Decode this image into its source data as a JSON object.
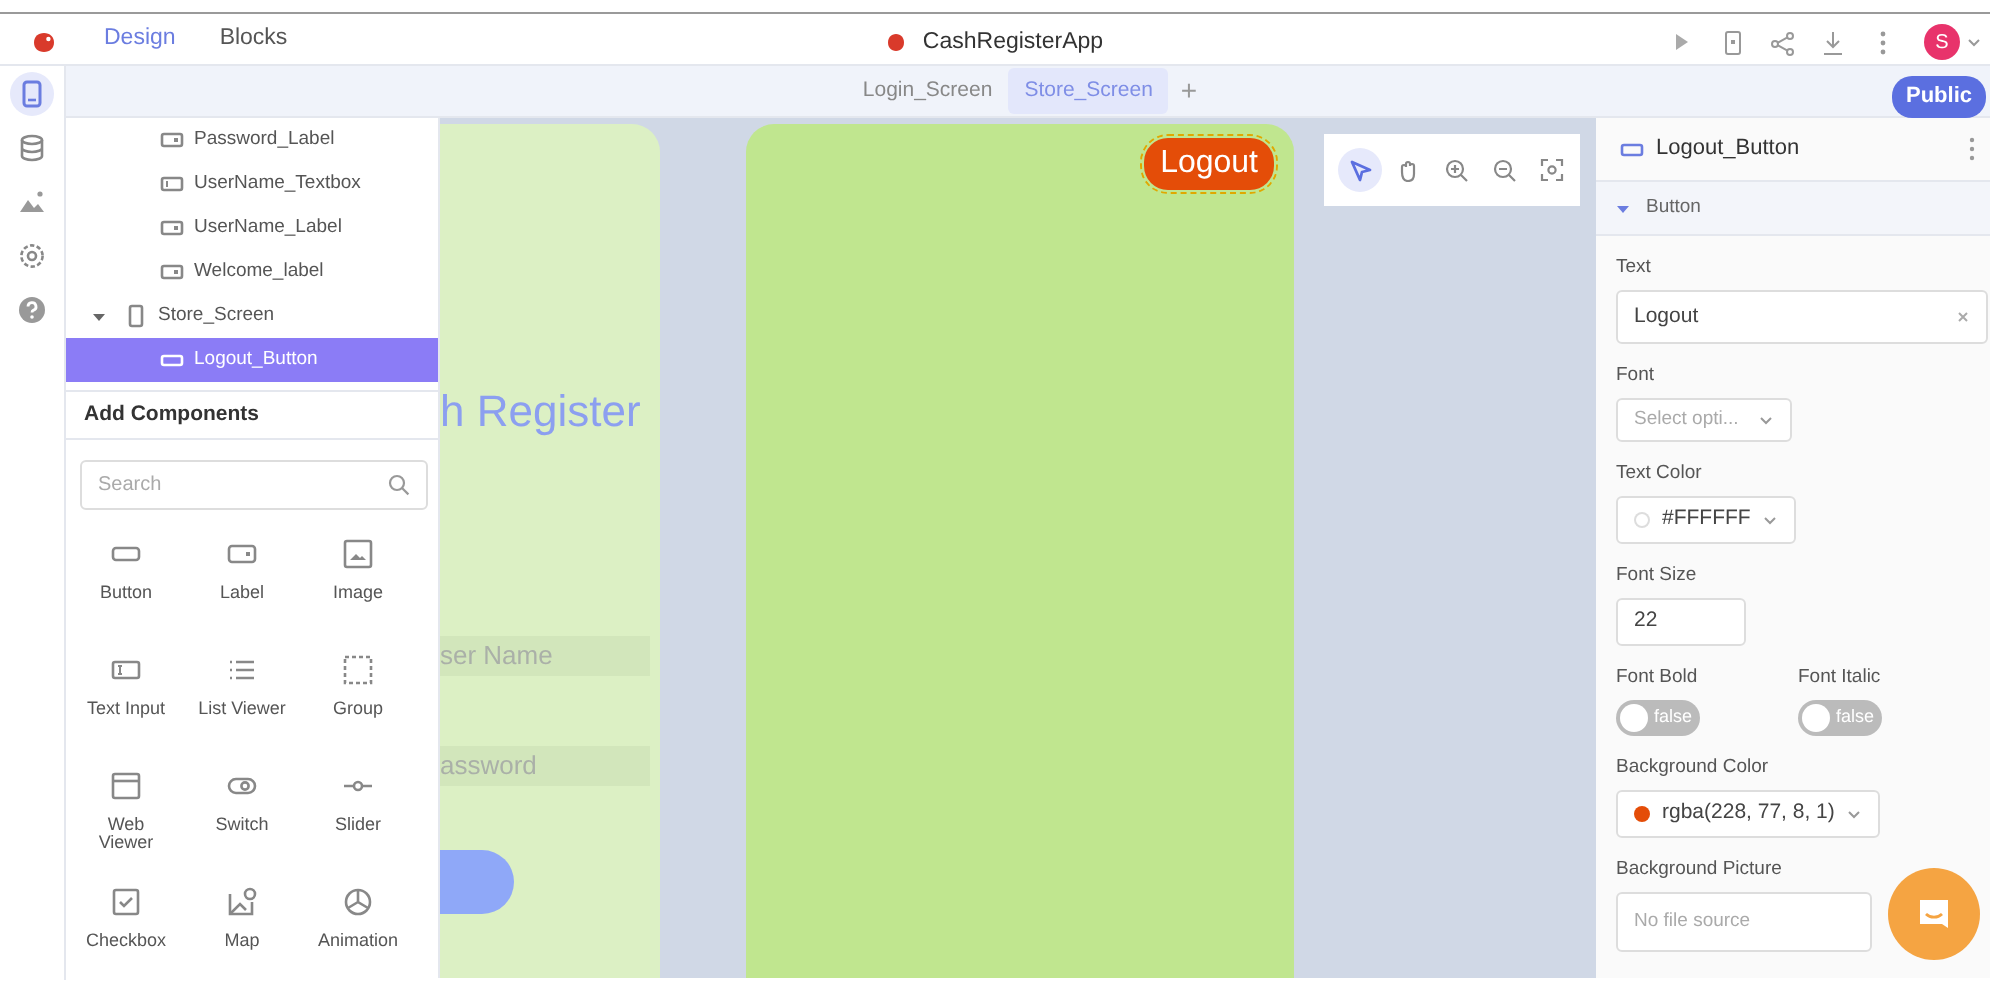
{
  "app": {
    "title": "CashRegisterApp"
  },
  "mode_tabs": [
    {
      "label": "Design",
      "selected": true
    },
    {
      "label": "Blocks",
      "selected": false
    }
  ],
  "avatar": {
    "initial": "S"
  },
  "rail": [
    {
      "kind": "device",
      "selected": true
    },
    {
      "kind": "database",
      "selected": false
    },
    {
      "kind": "media",
      "selected": false
    },
    {
      "kind": "settings",
      "selected": false
    },
    {
      "kind": "help",
      "selected": false
    }
  ],
  "screen_tabs": [
    {
      "label": "Login_Screen",
      "selected": false
    },
    {
      "label": "Store_Screen",
      "selected": true
    }
  ],
  "add_tab": "+",
  "visibility_badge": "Public",
  "tree": [
    {
      "children": [
        {
          "label": "Password_Label",
          "kind": "label",
          "selected": false
        },
        {
          "label": "UserName_Textbox",
          "kind": "textbox",
          "selected": false
        },
        {
          "label": "UserName_Label",
          "kind": "label",
          "selected": false
        },
        {
          "label": "Welcome_label",
          "kind": "label",
          "selected": false
        }
      ]
    },
    {
      "label": "Store_Screen",
      "kind": "screen",
      "expanded": true,
      "selected": false,
      "children": [
        {
          "label": "Logout_Button",
          "kind": "button",
          "selected": true
        }
      ]
    }
  ],
  "add_components": {
    "title": "Add Components",
    "search": {
      "placeholder": "Search"
    },
    "items": [
      {
        "label": "Button",
        "kind": "button"
      },
      {
        "label": "Label",
        "kind": "label"
      },
      {
        "label": "Image",
        "kind": "image"
      },
      {
        "label": "Text Input",
        "kind": "text_input"
      },
      {
        "label": "List Viewer",
        "kind": "list_viewer"
      },
      {
        "label": "Group",
        "kind": "group"
      },
      {
        "label": "Web Viewer",
        "kind": "web_viewer"
      },
      {
        "label": "Switch",
        "kind": "switch"
      },
      {
        "label": "Slider",
        "kind": "slider"
      },
      {
        "label": "Checkbox",
        "kind": "checkbox"
      },
      {
        "label": "Map",
        "kind": "map"
      },
      {
        "label": "Animation",
        "kind": "animation"
      }
    ]
  },
  "login_preview": {
    "heading": "h Register",
    "fields": [
      "ser Name",
      "assword"
    ]
  },
  "store_preview": {
    "button": "Logout",
    "selected": true
  },
  "tools": [
    {
      "kind": "pointer",
      "selected": true
    },
    {
      "kind": "hand",
      "selected": false
    },
    {
      "kind": "zoom_in",
      "selected": false
    },
    {
      "kind": "zoom_out",
      "selected": false
    },
    {
      "kind": "fit",
      "selected": false
    }
  ],
  "inspector": {
    "title": "Logout_Button",
    "section": "Button",
    "expanded": true,
    "properties": [
      {
        "kind": "text",
        "label": "Text",
        "value": "Logout"
      },
      {
        "kind": "select",
        "label": "Font",
        "placeholder": "Select opti..."
      },
      {
        "kind": "color",
        "label": "Text Color",
        "value": "#FFFFFF",
        "color": "#ffffff"
      },
      {
        "kind": "number",
        "label": "Font Size",
        "value": "22"
      },
      {
        "kind": "toggles",
        "items": [
          {
            "label": "Font Bold",
            "on": false,
            "state_text": "false"
          },
          {
            "label": "Font Italic",
            "on": false,
            "state_text": "false"
          }
        ]
      },
      {
        "kind": "color",
        "label": "Background Color",
        "value": "rgba(228, 77, 8, 1)",
        "color": "#e44d08"
      },
      {
        "kind": "file",
        "label": "Background Picture",
        "placeholder": "No file source"
      }
    ]
  }
}
